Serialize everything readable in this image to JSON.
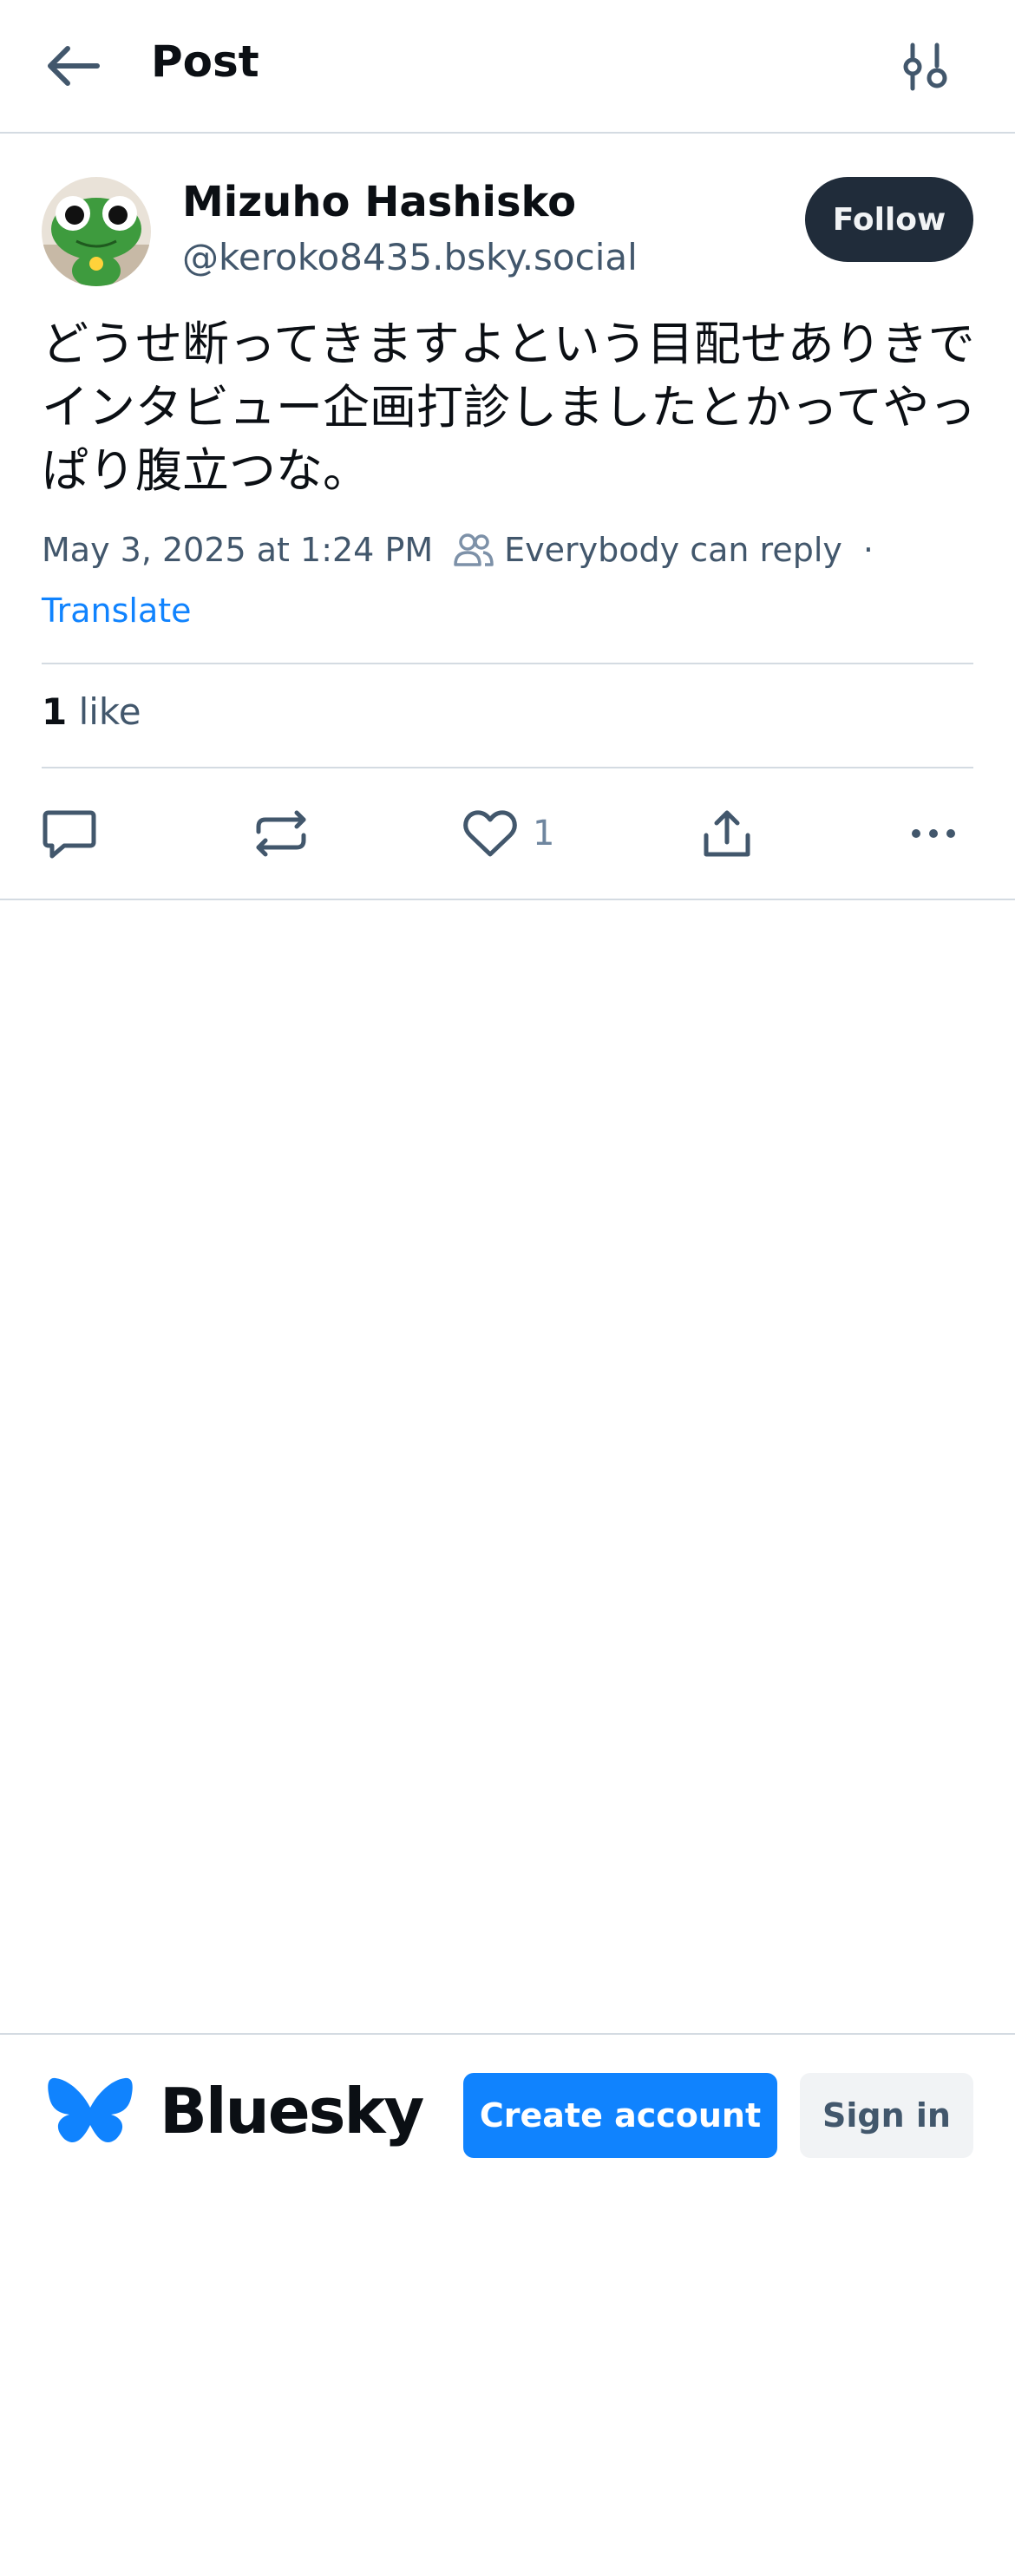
{
  "header": {
    "title": "Post",
    "back_icon": "arrow-left-icon",
    "filter_icon": "sliders-icon"
  },
  "author": {
    "name": "Mizuho Hashisko",
    "handle": "@keroko8435.bsky.social",
    "follow_label": "Follow",
    "avatar_icon": "frog-character-avatar"
  },
  "post": {
    "text": "どうせ断ってきますよという目配せありきでインタビュー企画打診しましたとかってやっぱり腹立つな。",
    "date": "May 3, 2025 at 1:24 PM",
    "reply_setting": "Everybody can reply",
    "separator": "·",
    "translate_label": "Translate"
  },
  "stats": {
    "like_count": "1",
    "like_label": "like"
  },
  "actions": {
    "reply_icon": "reply-icon",
    "repost_icon": "repost-icon",
    "like_icon": "heart-icon",
    "like_count": "1",
    "share_icon": "share-icon",
    "more_icon": "more-icon"
  },
  "footer": {
    "brand": "Bluesky",
    "logo_icon": "butterfly-logo-icon",
    "create_account_label": "Create account",
    "sign_in_label": "Sign in"
  },
  "colors": {
    "accent": "#1083fe",
    "follow_bg": "#202c3a",
    "muted_text": "#42576c",
    "divider": "#d4dbe2"
  }
}
